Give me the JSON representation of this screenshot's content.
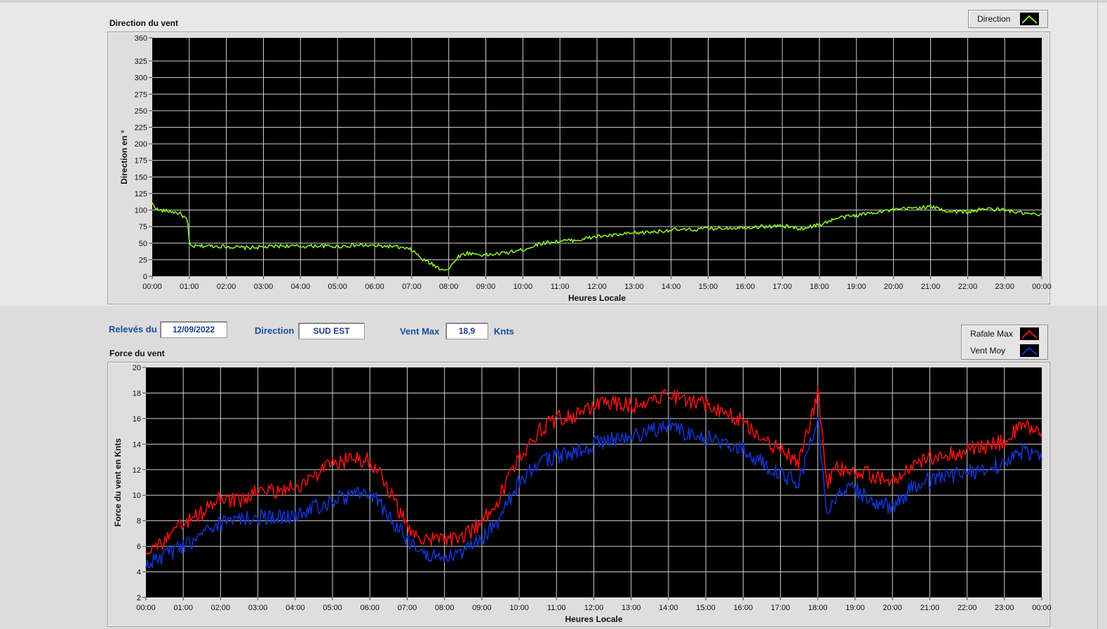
{
  "direction_chart": {
    "title": "Direction du vent",
    "legend": [
      {
        "label": "Direction",
        "color": "#88ee22"
      }
    ]
  },
  "force_chart": {
    "title": "Force du vent",
    "legend": [
      {
        "label": "Rafale Max",
        "color": "#ee1111"
      },
      {
        "label": "Vent Moy",
        "color": "#1133cc"
      }
    ]
  },
  "controls": {
    "date_label": "Relevés du",
    "date_value": "12/09/2022",
    "direction_label": "Direction",
    "direction_value": "SUD EST",
    "ventmax_label": "Vent Max",
    "ventmax_value": "18,9",
    "ventmax_unit": "Knts"
  },
  "chart_data": [
    {
      "type": "line",
      "title": "Direction du vent",
      "xlabel": "Heures Locale",
      "ylabel": "Direction en °",
      "xlim": [
        "00:00",
        "24:00"
      ],
      "ylim": [
        0,
        360
      ],
      "x_ticks": [
        "00:00",
        "01:00",
        "02:00",
        "03:00",
        "04:00",
        "05:00",
        "06:00",
        "07:00",
        "08:00",
        "09:00",
        "10:00",
        "11:00",
        "12:00",
        "13:00",
        "14:00",
        "15:00",
        "16:00",
        "17:00",
        "18:00",
        "19:00",
        "20:00",
        "21:00",
        "22:00",
        "23:00",
        "00:00"
      ],
      "y_ticks": [
        0,
        25,
        50,
        75,
        100,
        125,
        150,
        175,
        200,
        225,
        250,
        275,
        300,
        325,
        360
      ],
      "grid": true,
      "legend_position": "top-right",
      "series": [
        {
          "name": "Direction",
          "color": "#88ee22",
          "x_hours": [
            0,
            0.15,
            0.5,
            0.75,
            0.95,
            1.0,
            1.05,
            1.5,
            2.0,
            2.5,
            3.0,
            3.5,
            4.0,
            4.5,
            5.0,
            5.5,
            6.0,
            6.5,
            7.0,
            7.3,
            7.5,
            7.75,
            8.0,
            8.25,
            8.5,
            9.0,
            9.5,
            10.0,
            10.5,
            11.0,
            11.5,
            12.0,
            12.5,
            13.0,
            13.5,
            14.0,
            14.5,
            15.0,
            15.5,
            16.0,
            16.5,
            17.0,
            17.5,
            18.0,
            18.5,
            19.0,
            19.5,
            20.0,
            20.5,
            21.0,
            21.5,
            22.0,
            22.5,
            23.0,
            23.5,
            24.0
          ],
          "values": [
            110,
            100,
            98,
            95,
            85,
            50,
            45,
            46,
            45,
            43,
            44,
            46,
            45,
            46,
            45,
            47,
            46,
            45,
            40,
            25,
            20,
            12,
            10,
            30,
            35,
            32,
            35,
            40,
            50,
            53,
            55,
            60,
            62,
            65,
            67,
            70,
            70,
            72,
            73,
            74,
            75,
            76,
            72,
            78,
            88,
            92,
            97,
            100,
            103,
            105,
            98,
            97,
            102,
            100,
            95,
            92
          ]
        }
      ]
    },
    {
      "type": "line",
      "title": "Force du vent",
      "xlabel": "Heures Locale",
      "ylabel": "Force du vent en Knts",
      "xlim": [
        "00:00",
        "24:00"
      ],
      "ylim": [
        2,
        20
      ],
      "x_ticks": [
        "00:00",
        "01:00",
        "02:00",
        "03:00",
        "04:00",
        "05:00",
        "06:00",
        "07:00",
        "08:00",
        "09:00",
        "10:00",
        "11:00",
        "12:00",
        "13:00",
        "14:00",
        "15:00",
        "16:00",
        "17:00",
        "18:00",
        "19:00",
        "20:00",
        "21:00",
        "22:00",
        "23:00",
        "00:00"
      ],
      "y_ticks": [
        2,
        4,
        6,
        8,
        10,
        12,
        14,
        16,
        18,
        20
      ],
      "grid": true,
      "legend_position": "top-right",
      "series": [
        {
          "name": "Rafale Max",
          "color": "#ee1111",
          "x_hours": [
            0,
            0.5,
            1.0,
            1.5,
            2.0,
            2.5,
            3.0,
            3.5,
            4.0,
            4.5,
            5.0,
            5.5,
            6.0,
            6.5,
            7.0,
            7.5,
            8.0,
            8.5,
            9.0,
            9.5,
            10.0,
            10.5,
            11.0,
            11.5,
            12.0,
            12.5,
            13.0,
            13.5,
            14.0,
            14.5,
            15.0,
            15.5,
            16.0,
            16.5,
            17.0,
            17.5,
            18.0,
            18.25,
            18.5,
            19.0,
            19.5,
            20.0,
            20.5,
            21.0,
            21.5,
            22.0,
            22.5,
            23.0,
            23.5,
            24.0
          ],
          "values": [
            5.8,
            6.3,
            7.8,
            8.6,
            9.8,
            9.5,
            10.3,
            10.4,
            10.6,
            11.5,
            12.4,
            12.8,
            12.8,
            10.5,
            7.5,
            6.5,
            6.5,
            6.8,
            7.8,
            10.0,
            13.0,
            15.0,
            16.0,
            16.2,
            17.0,
            17.3,
            17.0,
            17.5,
            18.0,
            17.3,
            17.2,
            16.5,
            15.8,
            14.5,
            13.5,
            12.5,
            18.0,
            11.0,
            12.0,
            12.0,
            11.5,
            11.0,
            12.0,
            13.0,
            13.2,
            13.5,
            13.8,
            14.2,
            15.5,
            14.8
          ]
        },
        {
          "name": "Vent Moy",
          "color": "#1133cc",
          "x_hours": [
            0,
            0.5,
            1.0,
            1.5,
            2.0,
            2.5,
            3.0,
            3.5,
            4.0,
            4.5,
            5.0,
            5.5,
            6.0,
            6.5,
            7.0,
            7.5,
            8.0,
            8.5,
            9.0,
            9.5,
            10.0,
            10.5,
            11.0,
            11.5,
            12.0,
            12.5,
            13.0,
            13.5,
            14.0,
            14.5,
            15.0,
            15.5,
            16.0,
            16.5,
            17.0,
            17.5,
            18.0,
            18.25,
            18.5,
            19.0,
            19.5,
            20.0,
            20.5,
            21.0,
            21.5,
            22.0,
            22.5,
            23.0,
            23.5,
            24.0
          ],
          "values": [
            4.6,
            5.3,
            6.0,
            6.8,
            7.8,
            8.1,
            8.3,
            8.2,
            8.4,
            9.0,
            9.6,
            10.0,
            10.2,
            8.5,
            6.5,
            5.5,
            5.0,
            5.5,
            6.6,
            8.2,
            11.0,
            12.5,
            13.0,
            13.4,
            14.0,
            14.4,
            14.6,
            15.0,
            15.6,
            14.8,
            14.5,
            14.0,
            13.6,
            12.6,
            11.6,
            11.0,
            16.0,
            8.5,
            10.0,
            10.5,
            9.5,
            9.0,
            10.5,
            11.2,
            11.5,
            11.8,
            12.0,
            12.5,
            13.5,
            13.0
          ]
        }
      ]
    }
  ]
}
